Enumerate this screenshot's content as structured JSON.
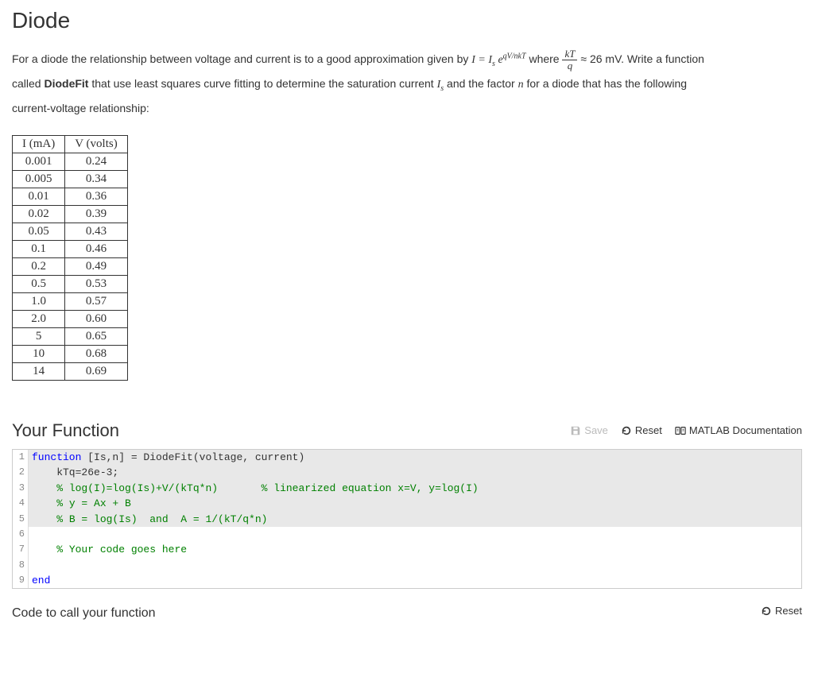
{
  "title": "Diode",
  "problem": {
    "intro_before_formula": "For a diode the relationship between voltage and current is to a good approximation given by ",
    "formula_text": "I = I_s e^(qV/nkT)",
    "where_label": "where",
    "frac_num": "kT",
    "frac_den": "q",
    "approx_text": " ≈ 26 mV.  Write a function",
    "line2_a": "called ",
    "bold_name": "DiodeFit",
    "line2_b": " that use least squares curve fitting to determine the saturation current ",
    "is_sym": "I_s",
    "line2_c": " and the factor ",
    "n_sym": "n",
    "line2_d": " for a diode that has the following",
    "line3": "current-voltage relationship:"
  },
  "table": {
    "header_i": "I (mA)",
    "header_v": "V (volts)",
    "rows": [
      {
        "i": "0.001",
        "v": "0.24"
      },
      {
        "i": "0.005",
        "v": "0.34"
      },
      {
        "i": "0.01",
        "v": "0.36"
      },
      {
        "i": "0.02",
        "v": "0.39"
      },
      {
        "i": "0.05",
        "v": "0.43"
      },
      {
        "i": "0.1",
        "v": "0.46"
      },
      {
        "i": "0.2",
        "v": "0.49"
      },
      {
        "i": "0.5",
        "v": "0.53"
      },
      {
        "i": "1.0",
        "v": "0.57"
      },
      {
        "i": "2.0",
        "v": "0.60"
      },
      {
        "i": "5",
        "v": "0.65"
      },
      {
        "i": "10",
        "v": "0.68"
      },
      {
        "i": "14",
        "v": "0.69"
      }
    ]
  },
  "your_function": {
    "heading": "Your Function",
    "save_label": "Save",
    "reset_label": "Reset",
    "doc_label": "MATLAB Documentation"
  },
  "code": {
    "lines": [
      {
        "n": "1",
        "sel": true,
        "segments": [
          {
            "t": "function",
            "c": "kw"
          },
          {
            "t": " [Is,n] = DiodeFit(voltage, current)"
          }
        ]
      },
      {
        "n": "2",
        "sel": true,
        "segments": [
          {
            "t": "    kTq=26e-3;"
          }
        ]
      },
      {
        "n": "3",
        "sel": true,
        "segments": [
          {
            "t": "    "
          },
          {
            "t": "% log(I)=log(Is)+V/(kTq*n)       % linearized equation x=V, y=log(I)",
            "c": "com"
          }
        ]
      },
      {
        "n": "4",
        "sel": true,
        "segments": [
          {
            "t": "    "
          },
          {
            "t": "% y = Ax + B",
            "c": "com"
          }
        ]
      },
      {
        "n": "5",
        "sel": true,
        "segments": [
          {
            "t": "    "
          },
          {
            "t": "% B = log(Is)  and  A = 1/(kT/q*n)",
            "c": "com"
          }
        ]
      },
      {
        "n": "6",
        "sel": false,
        "segments": []
      },
      {
        "n": "7",
        "sel": false,
        "segments": [
          {
            "t": "    "
          },
          {
            "t": "% Your code goes here",
            "c": "com"
          }
        ]
      },
      {
        "n": "8",
        "sel": false,
        "segments": []
      },
      {
        "n": "9",
        "sel": false,
        "segments": [
          {
            "t": "end",
            "c": "kw"
          }
        ]
      }
    ]
  },
  "call_section": {
    "heading": "Code to call your function",
    "reset_label": "Reset"
  }
}
